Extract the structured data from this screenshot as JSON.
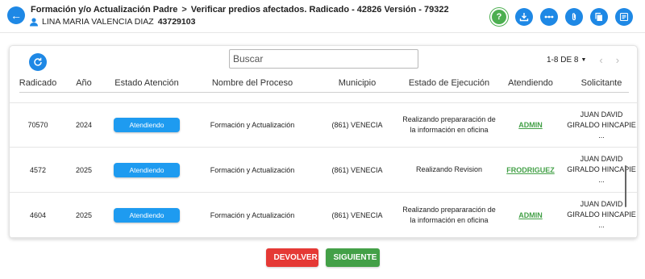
{
  "header": {
    "breadcrumb": [
      "Formación y/o Actualización Padre",
      "Verificar predios afectados. Radicado - 42826 Versión - 79322"
    ],
    "user_name": "LINA MARIA VALENCIA DIAZ",
    "user_id": "43729103"
  },
  "toolbar": {
    "search_placeholder": "Buscar",
    "pagination": "1-8 DE 8"
  },
  "table": {
    "columns": [
      "Radicado",
      "Año",
      "Estado Atención",
      "Nombre del Proceso",
      "Municipio",
      "Estado de Ejecución",
      "Atendiendo",
      "Solicitante"
    ],
    "rows": [
      {
        "radicado": "70570",
        "anio": "2024",
        "estado": "Atendiendo",
        "proceso": "Formación y Actualización",
        "municipio": "(861) VENECIA",
        "ejecucion_1": "Realizando prepararación de",
        "ejecucion_2": "la información en oficina",
        "atendiendo": "ADMIN",
        "sol_1": "JUAN DAVID",
        "sol_2": "GIRALDO HINCAPIE",
        "sol_3": "..."
      },
      {
        "radicado": "4572",
        "anio": "2025",
        "estado": "Atendiendo",
        "proceso": "Formación y Actualización",
        "municipio": "(861) VENECIA",
        "ejecucion_1": "Realizando Revision",
        "ejecucion_2": "",
        "atendiendo": "FRODRIGUEZ",
        "sol_1": "JUAN DAVID",
        "sol_2": "GIRALDO HINCAPIE",
        "sol_3": "..."
      },
      {
        "radicado": "4604",
        "anio": "2025",
        "estado": "Atendiendo",
        "proceso": "Formación y Actualización",
        "municipio": "(861) VENECIA",
        "ejecucion_1": "Realizando prepararación de",
        "ejecucion_2": "la información en oficina",
        "atendiendo": "ADMIN",
        "sol_1": "JUAN DAVID",
        "sol_2": "GIRALDO HINCAPIE",
        "sol_3": "..."
      }
    ]
  },
  "actions": {
    "devolver": "DEVOLVER",
    "siguiente": "SIGUIENTE"
  },
  "icons": {
    "back": "arrow-left-icon",
    "help": "help-icon",
    "download": "download-icon",
    "connect": "connect-icon",
    "attach": "paperclip-icon",
    "copy": "copy-icon",
    "notes": "notes-icon",
    "refresh": "refresh-icon"
  },
  "colors": {
    "primary": "#1e88e5",
    "success": "#43a047",
    "danger": "#e53935",
    "status_pill": "#1e9bf0"
  }
}
